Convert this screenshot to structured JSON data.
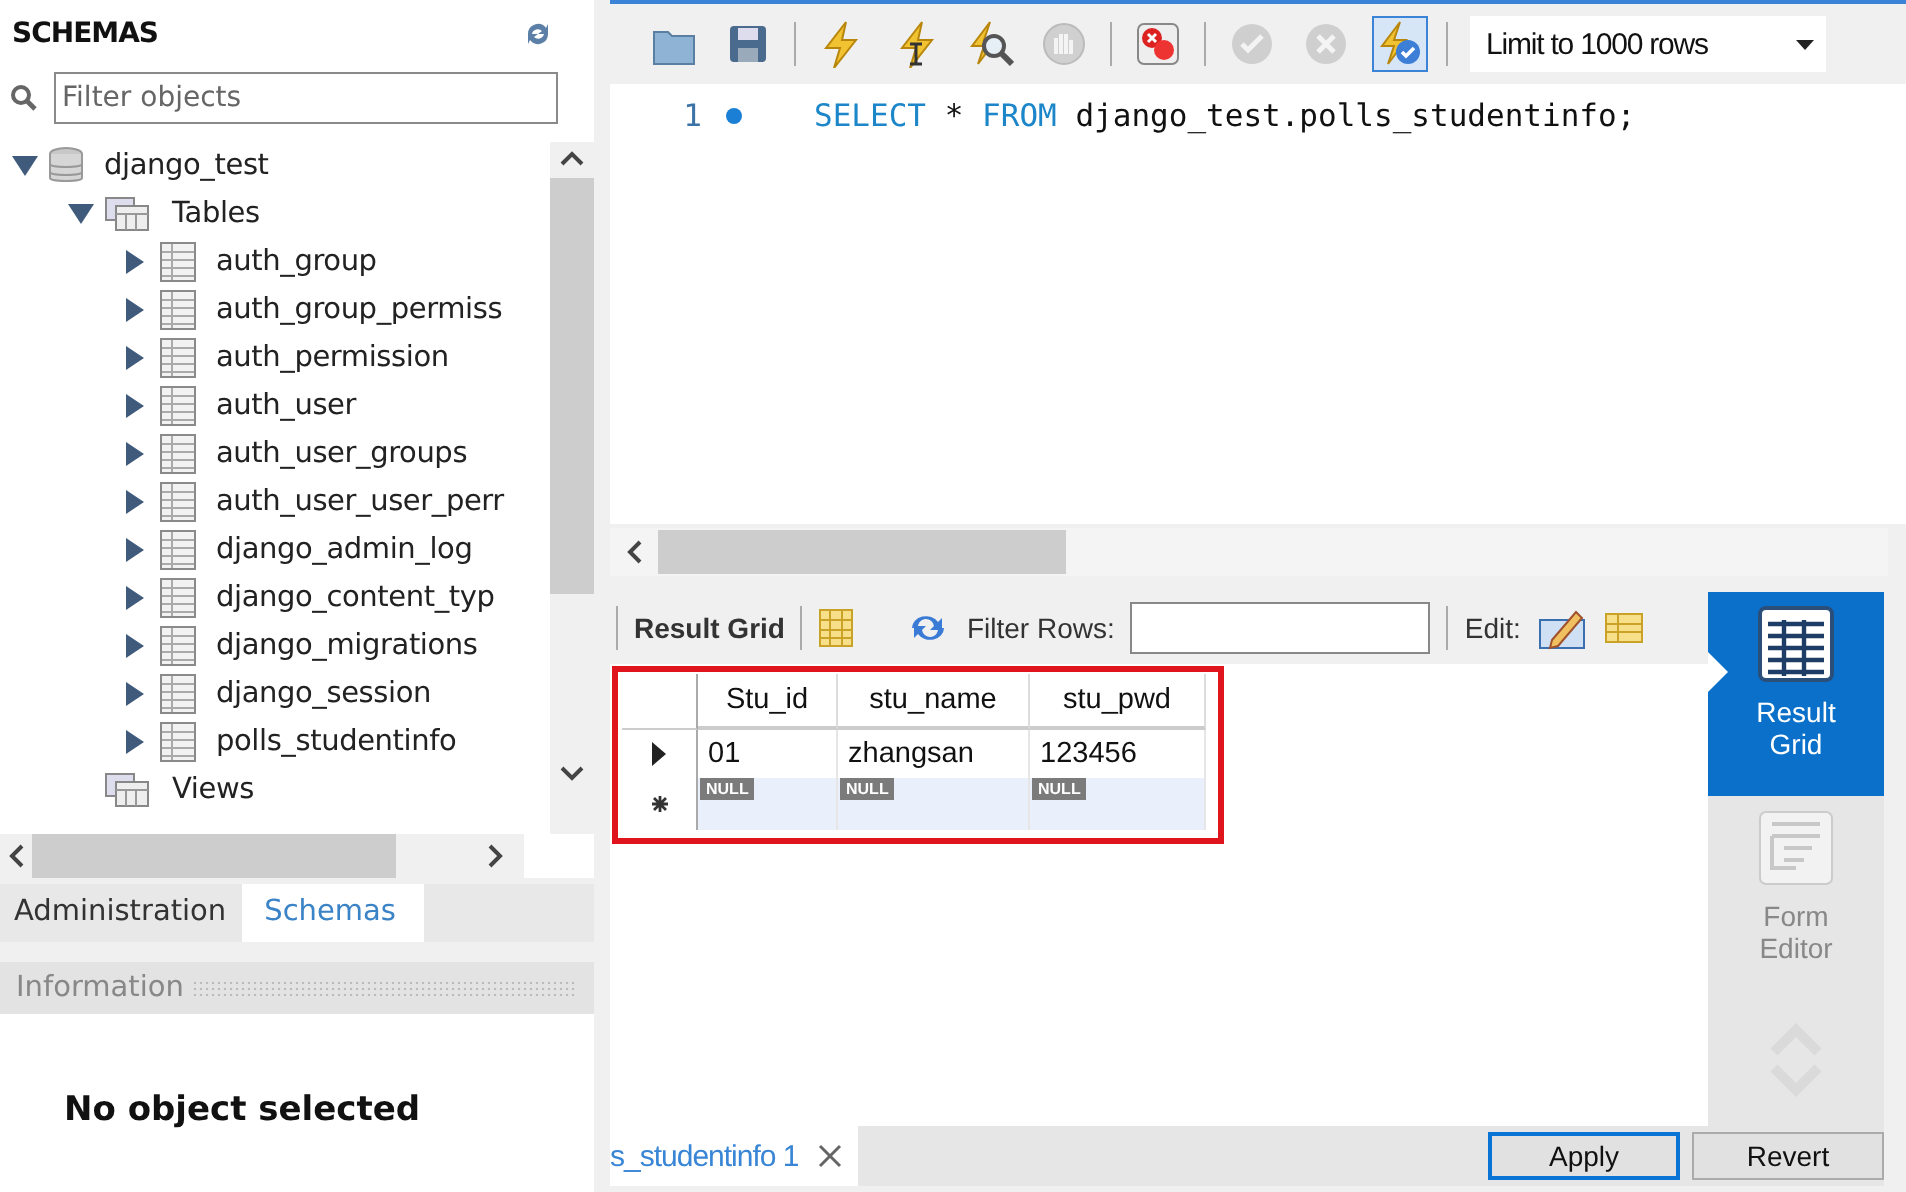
{
  "navigator": {
    "title": "SCHEMAS",
    "filter": {
      "placeholder": "Filter objects"
    },
    "tree": [
      {
        "label": "django_test",
        "kind": "schema",
        "expanded": true,
        "children": [
          {
            "label": "Tables",
            "kind": "folder",
            "expanded": true,
            "children": [
              {
                "label": "auth_group",
                "kind": "table",
                "expanded": false
              },
              {
                "label": "auth_group_permiss",
                "kind": "table",
                "expanded": false
              },
              {
                "label": "auth_permission",
                "kind": "table",
                "expanded": false
              },
              {
                "label": "auth_user",
                "kind": "table",
                "expanded": false
              },
              {
                "label": "auth_user_groups",
                "kind": "table",
                "expanded": false
              },
              {
                "label": "auth_user_user_perr",
                "kind": "table",
                "expanded": false
              },
              {
                "label": "django_admin_log",
                "kind": "table",
                "expanded": false
              },
              {
                "label": "django_content_typ",
                "kind": "table",
                "expanded": false
              },
              {
                "label": "django_migrations",
                "kind": "table",
                "expanded": false
              },
              {
                "label": "django_session",
                "kind": "table",
                "expanded": false
              },
              {
                "label": "polls_studentinfo",
                "kind": "table",
                "expanded": false
              }
            ]
          },
          {
            "label": "Views",
            "kind": "folder"
          }
        ]
      }
    ],
    "tabs": [
      {
        "label": "Administration",
        "selected": false
      },
      {
        "label": "Schemas",
        "selected": true
      }
    ],
    "information": {
      "title": "Information",
      "message": "No object selected"
    }
  },
  "editor": {
    "toolbar": [
      {
        "kind": "open-folder",
        "selected": false
      },
      {
        "kind": "save",
        "selected": false
      },
      {
        "kind": "sep"
      },
      {
        "kind": "execute",
        "selected": false
      },
      {
        "kind": "execute-current",
        "selected": false
      },
      {
        "kind": "explain",
        "selected": false
      },
      {
        "kind": "stop",
        "selected": false
      },
      {
        "kind": "sep"
      },
      {
        "kind": "toggle-error",
        "selected": false
      },
      {
        "kind": "sep"
      },
      {
        "kind": "commit",
        "selected": false
      },
      {
        "kind": "rollback",
        "selected": false
      },
      {
        "kind": "autocommit",
        "selected": true
      },
      {
        "kind": "sep"
      }
    ],
    "limit": "Limit to 1000 rows",
    "lines": [
      {
        "number": "1",
        "tokens": [
          {
            "text": "SELECT",
            "kind": "keyword"
          },
          {
            "text": "*",
            "kind": "plain"
          },
          {
            "text": "FROM",
            "kind": "keyword"
          },
          {
            "text": "django_test.polls_studentinfo;",
            "kind": "plain"
          }
        ]
      }
    ]
  },
  "result": {
    "title": "Result Grid",
    "filter_label": "Filter Rows:",
    "edit_label": "Edit:",
    "columns": [
      "Stu_id",
      "stu_name",
      "stu_pwd"
    ],
    "rows": [
      {
        "kind": "current",
        "cells": [
          "01",
          "zhangsan",
          "123456"
        ]
      },
      {
        "kind": "new",
        "cells": [
          "NULL",
          "NULL",
          "NULL"
        ]
      }
    ],
    "side": [
      {
        "label": "Result\nGrid",
        "kind": "grid",
        "selected": true
      },
      {
        "label": "Form\nEditor",
        "kind": "form",
        "selected": false
      }
    ],
    "tab": "s_studentinfo 1",
    "buttons": [
      {
        "label": "Apply",
        "focused": true
      },
      {
        "label": "Revert",
        "focused": false
      }
    ]
  }
}
